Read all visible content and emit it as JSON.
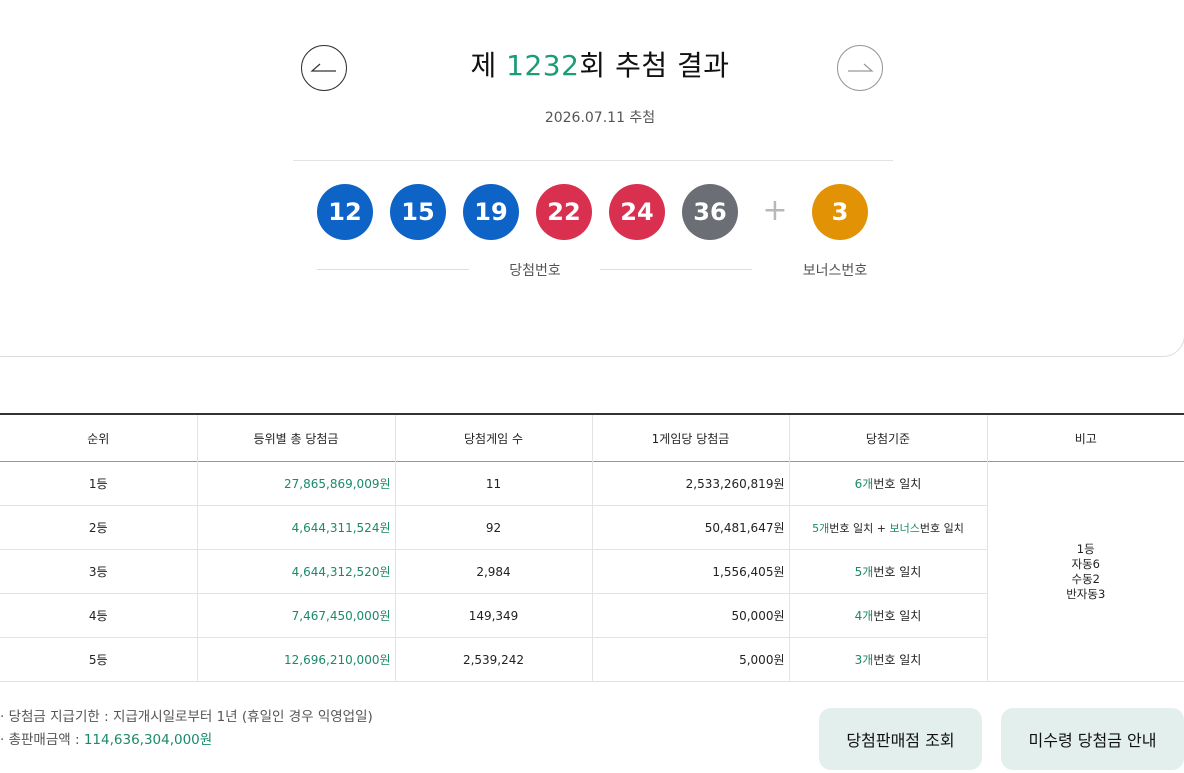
{
  "header": {
    "title_prefix": "제 ",
    "draw_number": "1232",
    "title_suffix": "회 추첨 결과",
    "date": "2026.07.11 추첨",
    "prev_icon": "arrow-left-icon",
    "next_icon": "arrow-right-icon"
  },
  "numbers": {
    "winning": [
      {
        "value": "12",
        "color": "#0e63c7"
      },
      {
        "value": "15",
        "color": "#0e63c7"
      },
      {
        "value": "19",
        "color": "#0e63c7"
      },
      {
        "value": "22",
        "color": "#d9304f"
      },
      {
        "value": "24",
        "color": "#d9304f"
      },
      {
        "value": "36",
        "color": "#6b6e75"
      }
    ],
    "plus": "+",
    "bonus": {
      "value": "3",
      "color": "#e29305"
    },
    "winning_label": "당첨번호",
    "bonus_label": "보너스번호"
  },
  "table": {
    "headers": [
      "순위",
      "등위별 총 당첨금",
      "당첨게임 수",
      "1게임당 당첨금",
      "당첨기준",
      "비고"
    ],
    "rows": [
      {
        "rank": "1등",
        "total": "27,865,869,009원",
        "games": "11",
        "per_game": "2,533,260,819원",
        "criteria_a": "6개",
        "criteria_b": "번호 일치"
      },
      {
        "rank": "2등",
        "total": "4,644,311,524원",
        "games": "92",
        "per_game": "50,481,647원",
        "criteria_a": "5개",
        "criteria_b": "번호 일치 + ",
        "criteria_c": "보너스",
        "criteria_d": "번호 일치"
      },
      {
        "rank": "3등",
        "total": "4,644,312,520원",
        "games": "2,984",
        "per_game": "1,556,405원",
        "criteria_a": "5개",
        "criteria_b": "번호 일치"
      },
      {
        "rank": "4등",
        "total": "7,467,450,000원",
        "games": "149,349",
        "per_game": "50,000원",
        "criteria_a": "4개",
        "criteria_b": "번호 일치"
      },
      {
        "rank": "5등",
        "total": "12,696,210,000원",
        "games": "2,539,242",
        "per_game": "5,000원",
        "criteria_a": "3개",
        "criteria_b": "번호 일치"
      }
    ],
    "remark": [
      "1등",
      "자동6",
      "수동2",
      "반자동3"
    ]
  },
  "notes": {
    "deadline": "· 당첨금 지급기한 : 지급개시일로부터 1년 (휴일인 경우 익영업일)",
    "sales_label": "· 총판매금액 : ",
    "sales_value": "114,636,304,000원"
  },
  "buttons": {
    "store_lookup": "당첨판매점 조회",
    "unclaimed": "미수령 당첨금 안내"
  }
}
